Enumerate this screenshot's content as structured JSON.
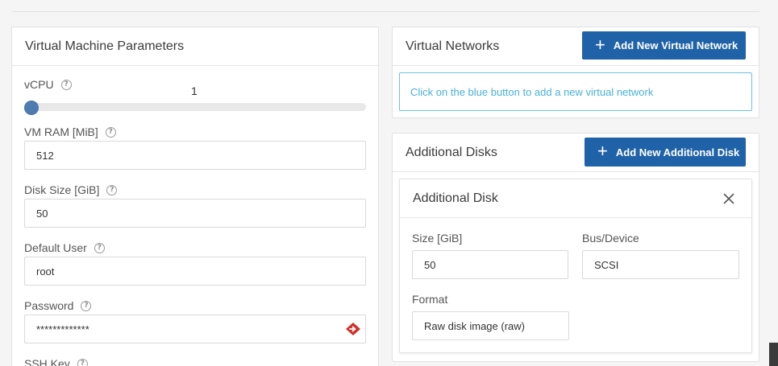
{
  "vm_params": {
    "title": "Virtual Machine Parameters",
    "vcpu": {
      "label": "vCPU",
      "value": "1"
    },
    "ram": {
      "label": "VM RAM [MiB]",
      "value": "512"
    },
    "disk_size": {
      "label": "Disk Size [GiB]",
      "value": "50"
    },
    "default_user": {
      "label": "Default User",
      "value": "root"
    },
    "password": {
      "label": "Password",
      "value": "*************"
    },
    "ssh_key": {
      "label": "SSH Key"
    }
  },
  "virtual_networks": {
    "title": "Virtual Networks",
    "add_button": "Add New Virtual Network",
    "info": "Click on the blue button to add a new virtual network"
  },
  "additional_disks": {
    "title": "Additional Disks",
    "add_button": "Add New Additional Disk",
    "disk": {
      "title": "Additional Disk",
      "size_label": "Size [GiB]",
      "size_value": "50",
      "bus_label": "Bus/Device",
      "bus_value": "SCSI",
      "format_label": "Format",
      "format_value": "Raw disk image (raw)"
    }
  },
  "icons": {
    "help": "?",
    "plus": "+"
  },
  "colors": {
    "primary": "#2062a8",
    "info": "#48b0d8",
    "reveal_icon": "#d0312d"
  }
}
